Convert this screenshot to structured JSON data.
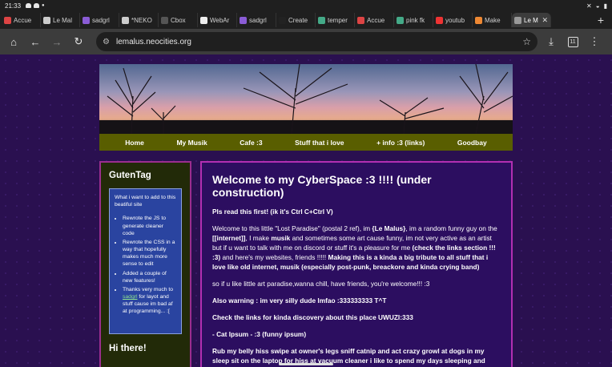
{
  "status_bar": {
    "time": "21:33"
  },
  "tabs": [
    {
      "label": "Accue",
      "color": "#d44",
      "active": false
    },
    {
      "label": "Le Mal",
      "color": "#ccc",
      "active": false
    },
    {
      "label": "sadgrl",
      "color": "#8a5cd6",
      "active": false
    },
    {
      "label": "*NEKO",
      "color": "#ccc",
      "active": false
    },
    {
      "label": "Cbox",
      "color": "#555",
      "active": false
    },
    {
      "label": "WebAr",
      "color": "#eee",
      "active": false
    },
    {
      "label": "sadgrl",
      "color": "#8a5cd6",
      "active": false
    },
    {
      "label": "Create",
      "color": "#222",
      "active": false
    },
    {
      "label": "temper",
      "color": "#4a8",
      "active": false
    },
    {
      "label": "Accue",
      "color": "#d44",
      "active": false
    },
    {
      "label": "pink fk",
      "color": "#4a8",
      "active": false
    },
    {
      "label": "youtub",
      "color": "#e33",
      "active": false
    },
    {
      "label": "Make",
      "color": "#e83",
      "active": false
    },
    {
      "label": "Le M",
      "color": "#999",
      "active": true
    }
  ],
  "toolbar": {
    "url": "lemalus.neocities.org",
    "tab_count": "11"
  },
  "nav": [
    "Home",
    "My Musik",
    "Cafe :3",
    "Stuff that i love",
    "+ info :3 (links)",
    "Goodbay"
  ],
  "sidebar": {
    "title": "GutenTag",
    "intro": "What i want to add to this beatiful site",
    "items": [
      "Rewrote the JS to generate cleaner code",
      "Rewrote the CSS in a way that hopefully makes much more sense to edit",
      "Added a couple of new features!"
    ],
    "thanks_pre": "Thanks very much to ",
    "thanks_link": "sadgrl",
    "thanks_post": " for layot and stuff cause im bad af at programming... :[",
    "title2": "Hi there!"
  },
  "main": {
    "title": "Welcome to my CyberSpace :3 !!!! (under construction)",
    "p_first": "Pls read this first! (ik it's Ctrl C+Ctrl V)",
    "p1_a": "Welcome to this little \"Lost Paradise\" (postal 2 ref), im ",
    "p1_b": "{Le Malus}",
    "p1_c": ", im a random funny guy on the ",
    "p1_d": "[[internet]]",
    "p1_e": ", I make ",
    "p1_f": "musik",
    "p1_g": " and sometimes some art cause funny, im not very active as an artist but if u want to talk with me on discord or stuff it's a pleasure for me ",
    "p1_h": "(check the links section !!! :3)",
    "p1_i": " and here's my websites, friends !!!!! ",
    "p1_j": "Making this is a kinda a big tribute to all stuff that i love like old internet, musik (especially post-punk, breackore and kinda crying band)",
    "p2": "so if u like little art paradise,wanna chill, have friends, you're welcome!!! :3",
    "p3": "Also warning : im very silly dude lmfao :333333333 T^T",
    "p4": "Check the links for kinda discovery about this place UWUZI:333",
    "p5": "- Cat Ipsum - :3 (funny ipsum)",
    "p6": "Rub my belly hiss swipe at owner's legs sniff catnip and act crazy growl at dogs in my sleep sit on the laptop for hiss at vacuum cleaner i like to spend my days sleeping and eating fishes that my human fished for me"
  }
}
